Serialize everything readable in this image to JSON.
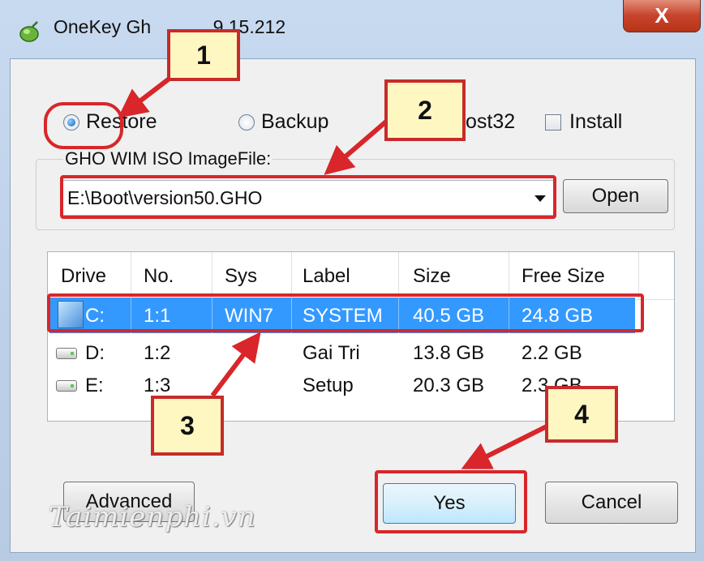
{
  "window": {
    "title": "OneKey Gh",
    "title_version": ".9.15.212",
    "close_glyph": "X"
  },
  "mode_options": [
    {
      "label": "Restore",
      "selected": true
    },
    {
      "label": "Backup",
      "selected": false
    },
    {
      "label": "ost32",
      "selected": false
    }
  ],
  "install_checkbox": {
    "label": "Install",
    "checked": false
  },
  "image_file": {
    "group_label": "GHO WIM ISO ImageFile:",
    "value": "E:\\Boot\\version50.GHO",
    "open_label": "Open"
  },
  "partition_table": {
    "columns": [
      "Drive",
      "No.",
      "Sys",
      "Label",
      "Size",
      "Free Size"
    ],
    "rows": [
      {
        "drive": "C:",
        "no": "1:1",
        "sys": "WIN7",
        "label": "SYSTEM",
        "size": "40.5 GB",
        "free": "24.8 GB",
        "selected": true
      },
      {
        "drive": "D:",
        "no": "1:2",
        "sys": "",
        "label": "Gai Tri",
        "size": "13.8 GB",
        "free": "2.2 GB",
        "selected": false
      },
      {
        "drive": "E:",
        "no": "1:3",
        "sys": "",
        "label": "Setup",
        "size": "20.3 GB",
        "free": "2.3 GB",
        "selected": false
      }
    ]
  },
  "buttons": {
    "advanced": "Advanced",
    "yes": "Yes",
    "cancel": "Cancel"
  },
  "callouts": [
    "1",
    "2",
    "3",
    "4"
  ],
  "watermark": "Taimienphi.vn",
  "colors": {
    "highlight": "#d8262a",
    "callout_fill": "#fff7c2",
    "selection": "#3399ff"
  }
}
